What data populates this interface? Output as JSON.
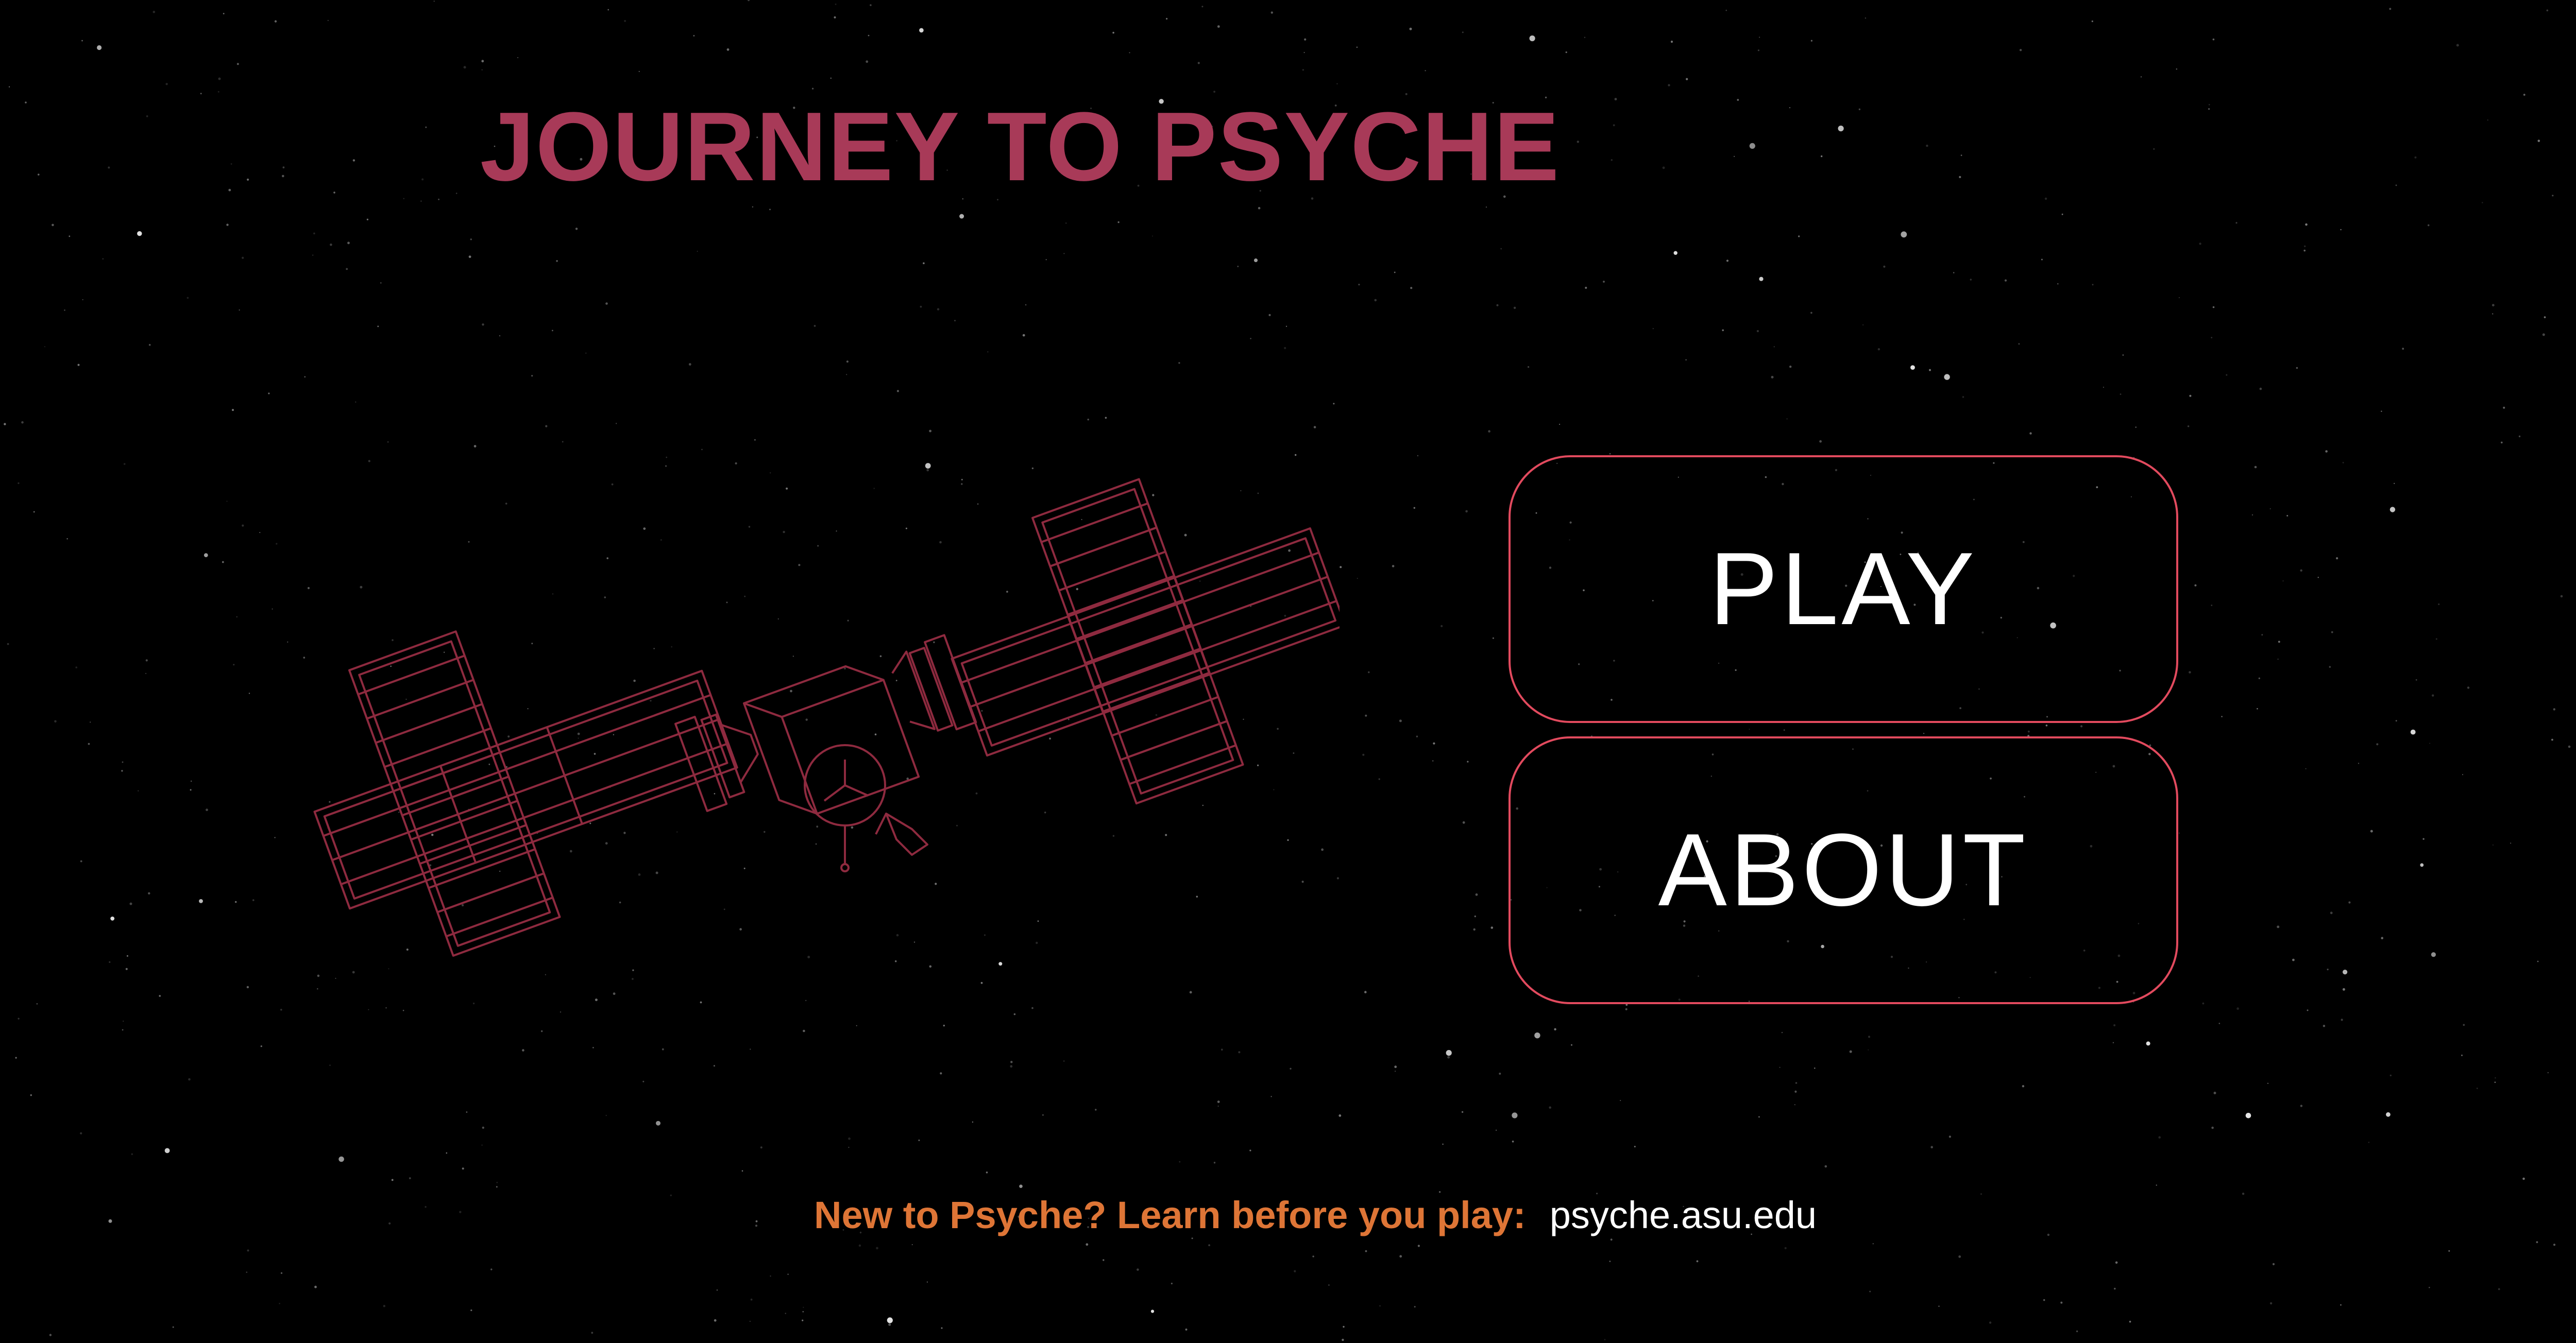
{
  "game": {
    "title": "JOURNEY TO PSYCHE"
  },
  "menu": {
    "play_label": "PLAY",
    "about_label": "ABOUT"
  },
  "footer": {
    "prompt": "New to Psyche? Learn before you play:",
    "link_text": "psyche.asu.edu"
  },
  "colors": {
    "background": "#000000",
    "title": "#a83a58",
    "button_border": "#e24a5e",
    "button_text": "#ffffff",
    "spacecraft_outline": "#8e2a3f",
    "footer_prompt": "#de7536",
    "footer_link": "#ffffff"
  },
  "icons": {
    "spacecraft": "psyche-spacecraft-wireframe-icon"
  }
}
